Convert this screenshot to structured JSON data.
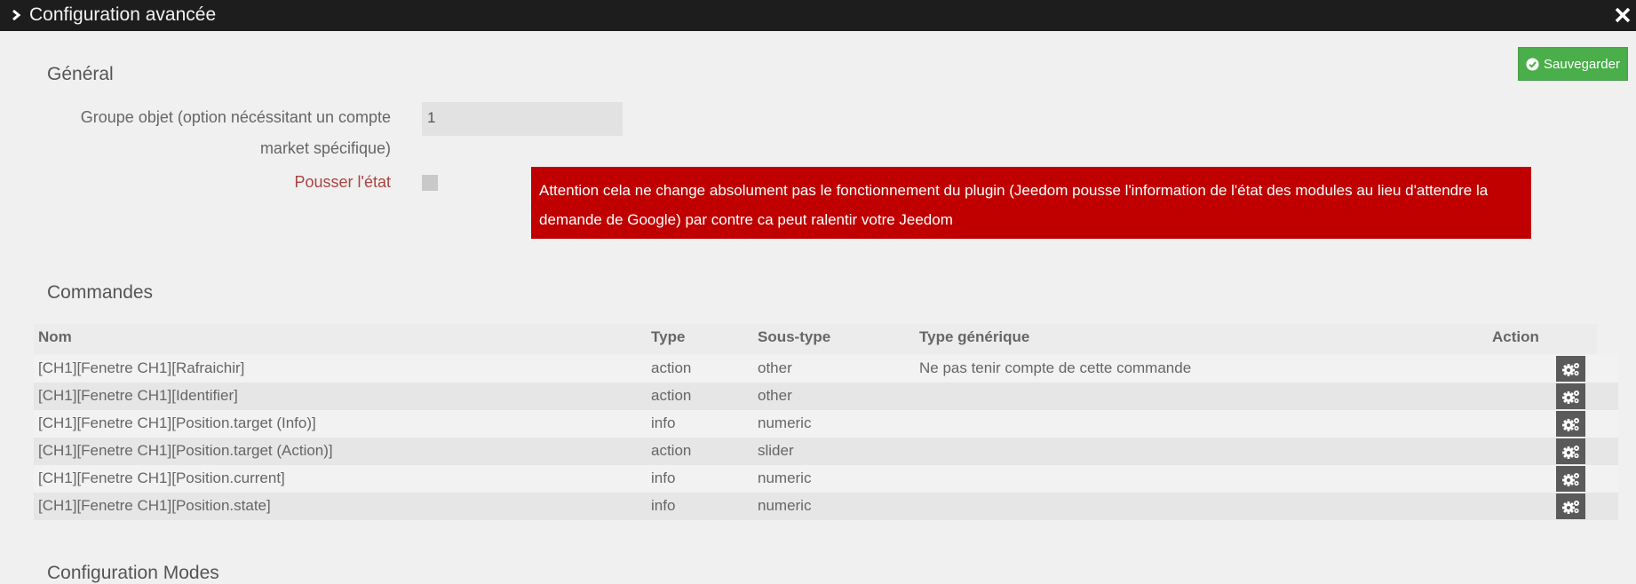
{
  "window": {
    "title": "Configuration avancée"
  },
  "toolbar": {
    "save_label": "Sauvegarder"
  },
  "general": {
    "section_title": "Général",
    "group_label_line1": "Groupe objet (option nécéssitant un compte",
    "group_label_line2": "market spécifique)",
    "group_value": "1",
    "push_label": "Pousser l'état",
    "push_checked": false,
    "alert_text": "Attention cela ne change absolument pas le fonctionnement du plugin (Jeedom pousse l'information de l'état des modules au lieu d'attendre la demande de Google) par contre ca peut ralentir votre Jeedom"
  },
  "commands": {
    "section_title": "Commandes",
    "headers": {
      "nom": "Nom",
      "type": "Type",
      "sous_type": "Sous-type",
      "type_generique": "Type générique",
      "action": "Action"
    },
    "rows": [
      {
        "nom": "[CH1][Fenetre CH1][Rafraichir]",
        "type": "action",
        "sous_type": "other",
        "type_generique": "Ne pas tenir compte de cette commande"
      },
      {
        "nom": "[CH1][Fenetre CH1][Identifier]",
        "type": "action",
        "sous_type": "other",
        "type_generique": ""
      },
      {
        "nom": "[CH1][Fenetre CH1][Position.target (Info)]",
        "type": "info",
        "sous_type": "numeric",
        "type_generique": ""
      },
      {
        "nom": "[CH1][Fenetre CH1][Position.target (Action)]",
        "type": "action",
        "sous_type": "slider",
        "type_generique": ""
      },
      {
        "nom": "[CH1][Fenetre CH1][Position.current]",
        "type": "info",
        "sous_type": "numeric",
        "type_generique": ""
      },
      {
        "nom": "[CH1][Fenetre CH1][Position.state]",
        "type": "info",
        "sous_type": "numeric",
        "type_generique": ""
      }
    ]
  },
  "modes": {
    "section_title": "Configuration Modes"
  },
  "icons": {
    "title_chevron": "chevron-right-icon",
    "close": "close-icon",
    "save": "check-circle-icon",
    "row_action": "gears-icon"
  },
  "colors": {
    "titlebar": "#1d1d1d",
    "save_button": "#4aae4a",
    "alert": "#c00000",
    "push_label": "#a94442",
    "action_button": "#5a5a5a"
  }
}
